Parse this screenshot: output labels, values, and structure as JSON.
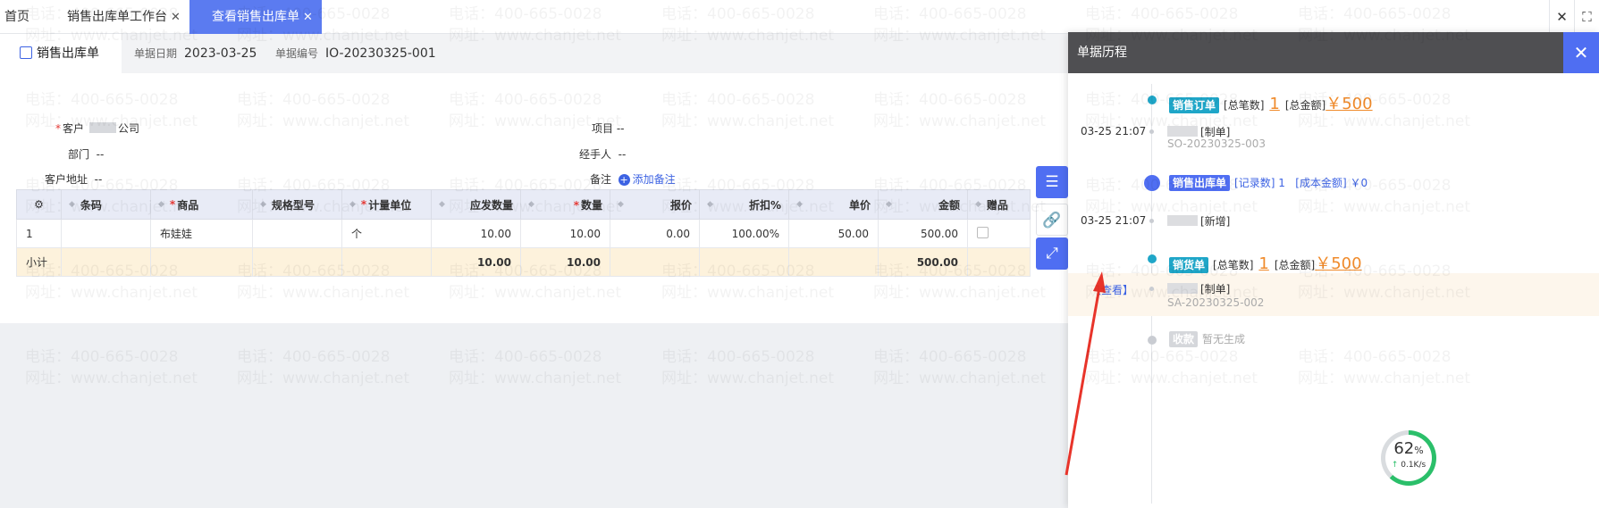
{
  "tabs": [
    {
      "label": "首页",
      "closable": false,
      "active": false
    },
    {
      "label": "销售出库单工作台",
      "closable": true,
      "active": false
    },
    {
      "label": "查看销售出库单",
      "closable": true,
      "active": true
    }
  ],
  "window": {
    "close": "✕",
    "fullscreen": "⛶"
  },
  "doc": {
    "name": "销售出库单",
    "date_label": "单据日期",
    "date_value": "2023-03-25",
    "no_label": "单据编号",
    "no_value": "IO-20230325-001"
  },
  "form": {
    "customer_label": "客户",
    "customer_value": "公司",
    "project_label": "项目",
    "project_value": "--",
    "dept_label": "部门",
    "dept_value": "--",
    "handler_label": "经手人",
    "handler_value": "--",
    "address_label": "客户地址",
    "address_value": "--",
    "remark_label": "备注",
    "add_remark": "添加备注"
  },
  "table": {
    "headers": [
      "条码",
      "商品",
      "规格型号",
      "计量单位",
      "应发数量",
      "数量",
      "报价",
      "折扣%",
      "单价",
      "金额",
      "赠品"
    ],
    "row": {
      "idx": "1",
      "barcode": "",
      "product": "布娃娃",
      "spec": "",
      "unit": "个",
      "planned_qty": "10.00",
      "qty": "10.00",
      "quote": "0.00",
      "discount": "100.00%",
      "price": "50.00",
      "amount": "500.00"
    },
    "subtotal": {
      "label": "小计",
      "planned_qty": "10.00",
      "qty": "10.00",
      "amount": "500.00"
    }
  },
  "history": {
    "title": "单据历程",
    "close": "✕",
    "events": [
      {
        "tag": "销售订单",
        "count_label": "[总笔数]",
        "count": "1",
        "amount_label": "[总金额]",
        "amount": "￥500",
        "time": "03-25 21:07",
        "person_suffix": "[制单]",
        "doc_no": "SO-20230325-003"
      },
      {
        "tag": "销售出库单",
        "count_label": "[记录数] 1",
        "cost_label": "[成本金额] ￥0",
        "time": "03-25 21:07",
        "person_suffix": "[新增]"
      },
      {
        "tag": "销货单",
        "count_label": "[总笔数]",
        "count": "1",
        "amount_label": "[总金额]",
        "amount": "￥500",
        "view": "【查看】",
        "person_suffix": "[制单]",
        "doc_no": "SA-20230325-002"
      },
      {
        "tag": "收款",
        "status": "暂无生成"
      }
    ]
  },
  "net": {
    "percent": "62",
    "unit": "%",
    "speed": "0.1K/s"
  },
  "watermark": {
    "phone": "电话：400-665-0028",
    "site": "网址：www.chanjet.net"
  },
  "colors": {
    "accent": "#4f6ef2",
    "tag": "#1fa6c8",
    "amount": "#f08a2a",
    "subtotal_bg": "#fdf2dc"
  }
}
